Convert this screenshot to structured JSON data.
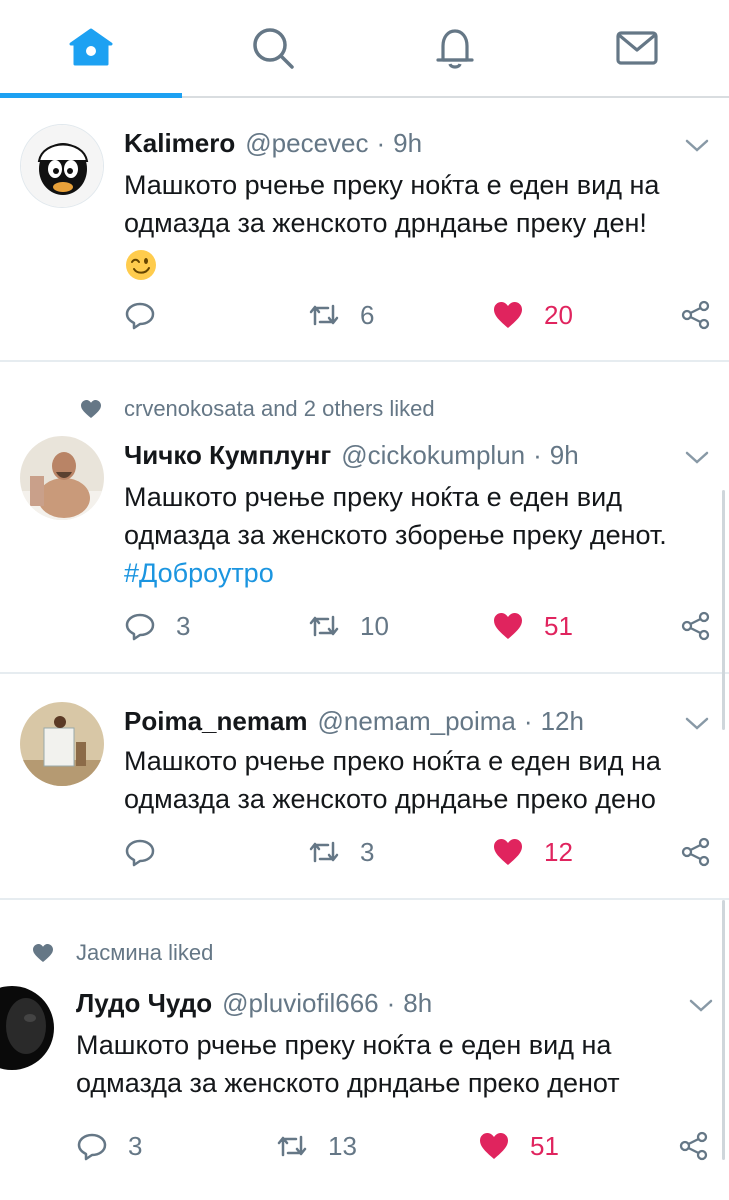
{
  "nav": {
    "tabs": [
      {
        "name": "home",
        "active": true
      },
      {
        "name": "search",
        "active": false
      },
      {
        "name": "notifications",
        "active": false
      },
      {
        "name": "messages",
        "active": false
      }
    ]
  },
  "colors": {
    "accent": "#1da1f2",
    "like": "#e0245e",
    "muted": "#657786",
    "hashtag": "#1b95e0"
  },
  "tweets": [
    {
      "social_context": "",
      "name": "Kalimero",
      "handle": "@pecevec",
      "dot": "·",
      "time": "9h",
      "text": "Машкото рчење преку нoќта е еден вид на одмазда за женското дрндање преку ден!",
      "hashtag": "",
      "emoji": "winking-face",
      "replies": "",
      "retweets": "6",
      "likes": "20"
    },
    {
      "social_context": "crvenokosata and 2 others liked",
      "name": "Чичко Кумплунг",
      "handle": "@cickokumplun",
      "dot": "·",
      "time": "9h",
      "text": "Машкото рчење преку нoќта е еден вид одмазда за женското зборење преку денот.",
      "hashtag": "#Доброутро",
      "emoji": "",
      "replies": "3",
      "retweets": "10",
      "likes": "51"
    },
    {
      "social_context": "",
      "name": "Poima_nemam",
      "handle": "@nemam_poima",
      "dot": "·",
      "time": "12h",
      "text": "Машкото рчење преко нoќта е еден вид на одмазда за женското дрндање преко дено",
      "hashtag": "",
      "emoji": "",
      "replies": "",
      "retweets": "3",
      "likes": "12"
    },
    {
      "social_context": "Jacмина liked",
      "name": "Лудо Чудо",
      "handle": "@pluviofil666",
      "dot": "·",
      "time": "8h",
      "text": "Машкото рчење преку нoќта е еден вид на одмазда за женското дрндање преко денот",
      "hashtag": "",
      "emoji": "",
      "replies": "3",
      "retweets": "13",
      "likes": "51"
    }
  ]
}
